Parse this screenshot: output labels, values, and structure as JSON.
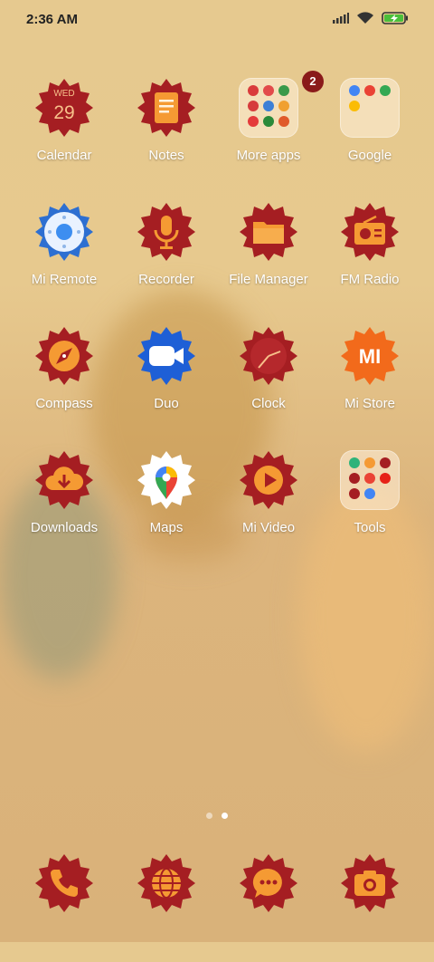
{
  "status": {
    "time": "2:36 AM"
  },
  "calendar": {
    "day": "WED",
    "date": "29"
  },
  "apps": {
    "calendar": "Calendar",
    "notes": "Notes",
    "more_apps": "More apps",
    "google": "Google",
    "mi_remote": "Mi Remote",
    "recorder": "Recorder",
    "file_manager": "File Manager",
    "fm_radio": "FM Radio",
    "compass": "Compass",
    "duo": "Duo",
    "clock": "Clock",
    "mi_store": "Mi Store",
    "downloads": "Downloads",
    "maps": "Maps",
    "mi_video": "Mi Video",
    "tools": "Tools"
  },
  "badge": {
    "more_apps": "2"
  },
  "mistore_logo": "MI",
  "pages": {
    "total": 2,
    "current": 2
  },
  "colors": {
    "accent_red": "#a51e22",
    "icon_orange": "#f08a2a",
    "folder_bg": "#f5e6cc"
  }
}
